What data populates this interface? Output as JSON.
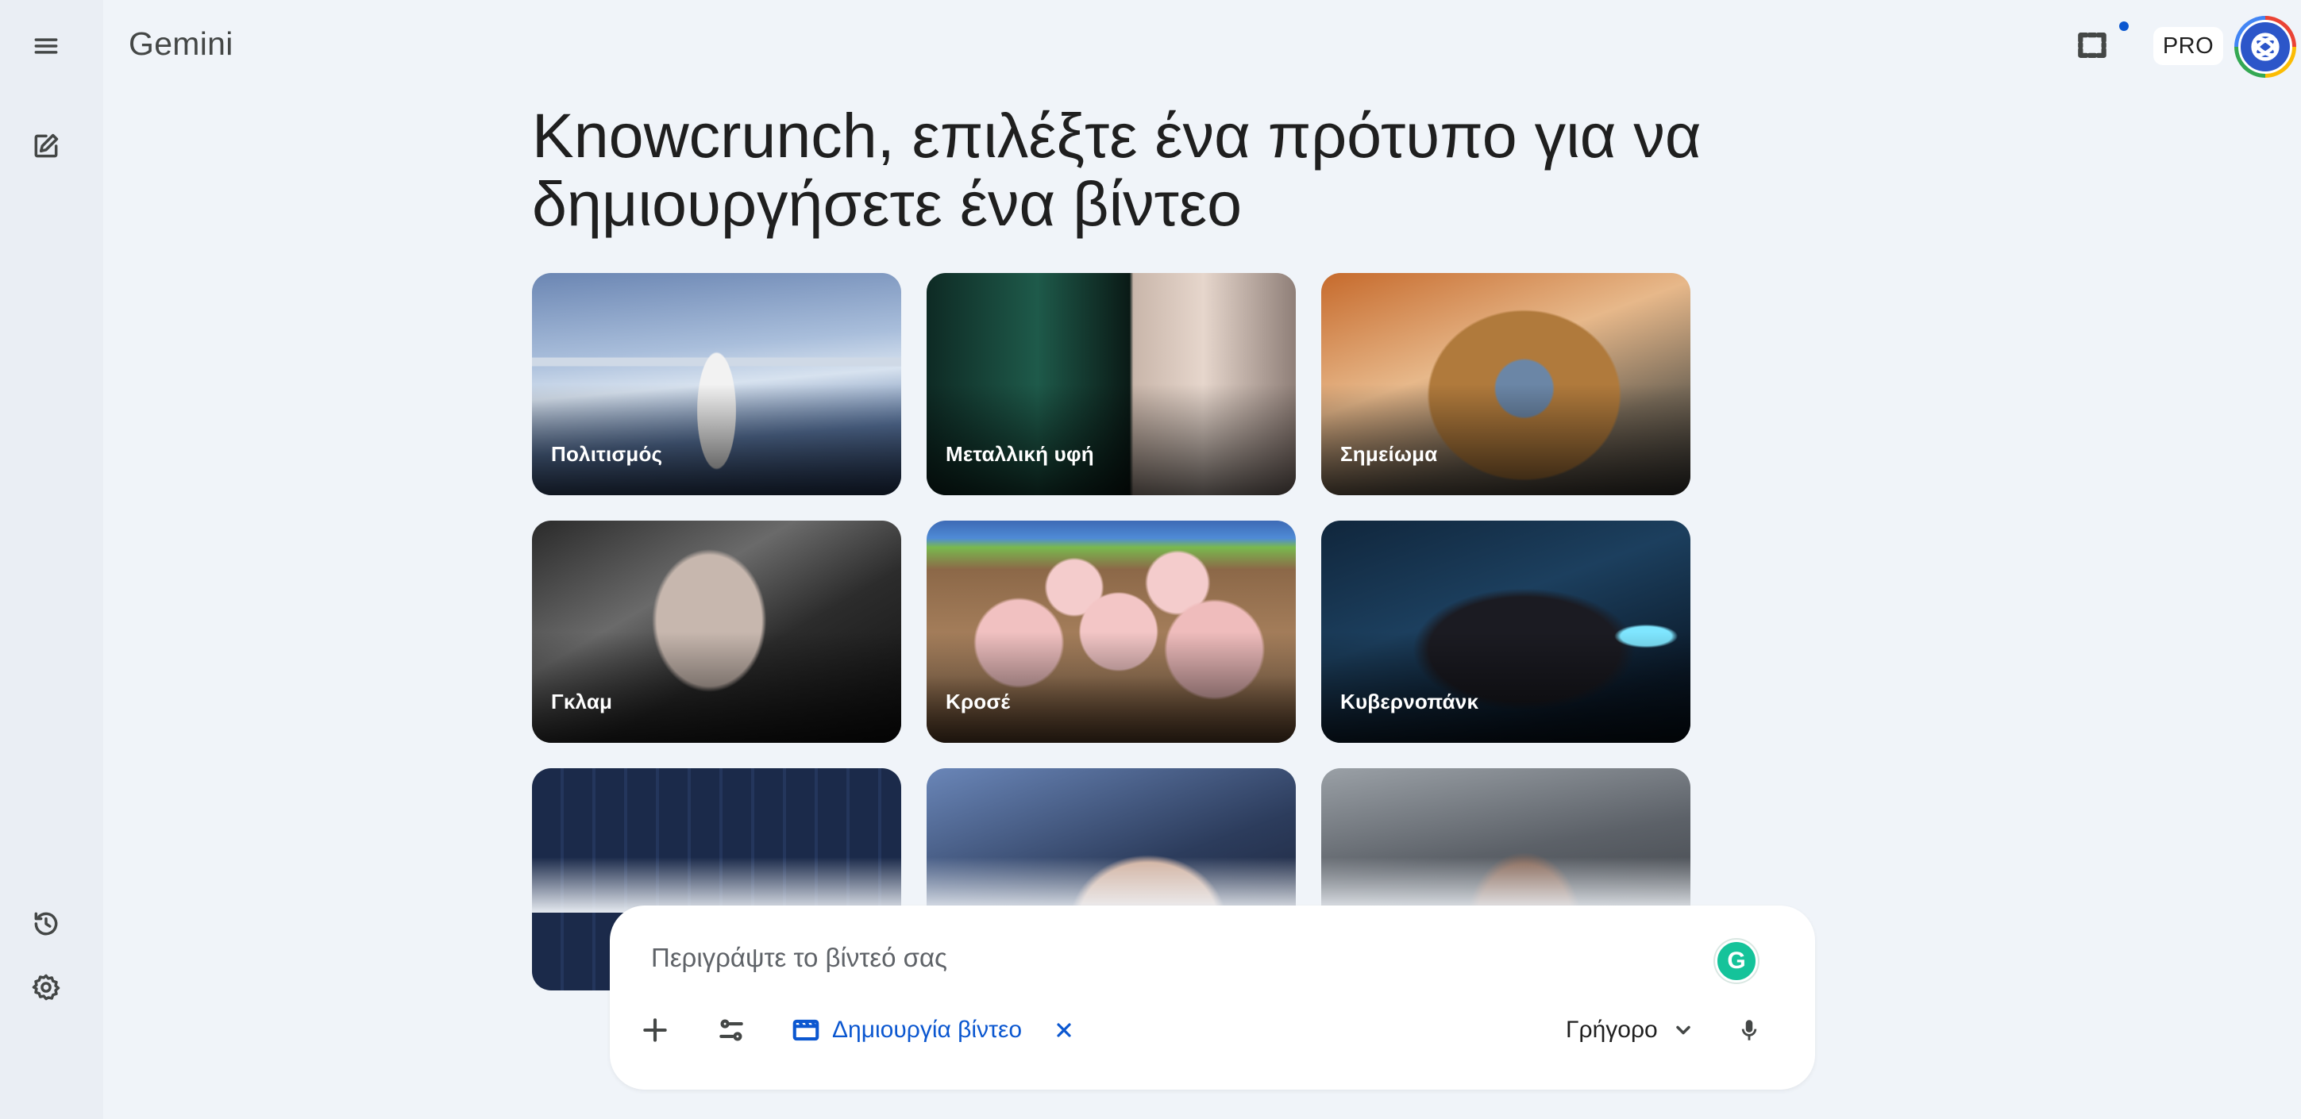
{
  "app": {
    "brand": "Gemini",
    "pro_label": "PRO"
  },
  "sidebar": {
    "items": [
      {
        "name": "menu",
        "icon": "menu-icon"
      },
      {
        "name": "new-chat",
        "icon": "edit-icon"
      },
      {
        "name": "activity",
        "icon": "history-icon"
      },
      {
        "name": "settings",
        "icon": "settings-icon"
      }
    ]
  },
  "heading": "Knowcrunch, επιλέξτε ένα πρότυπο για να δημιουργήσετε ένα βίντεο",
  "templates": [
    {
      "label": "Πολιτισμός"
    },
    {
      "label": "Μεταλλική υφή"
    },
    {
      "label": "Σημείωμα"
    },
    {
      "label": "Γκλαμ"
    },
    {
      "label": "Κροσέ"
    },
    {
      "label": "Κυβερνοπάνκ"
    },
    {
      "label": ""
    },
    {
      "label": ""
    },
    {
      "label": ""
    }
  ],
  "prompt": {
    "placeholder": "Περιγράψτε το βίντεό σας",
    "chip_label": "Δημιουργία βίντεο",
    "mode_label": "Γρήγορο"
  },
  "colors": {
    "accent": "#0b57d0",
    "background": "#f0f4f9",
    "sidebar": "#eaeef4"
  }
}
